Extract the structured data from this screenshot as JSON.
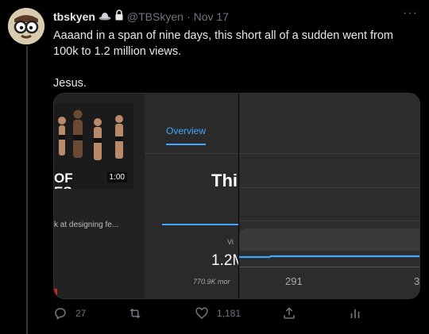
{
  "tweet": {
    "display_name": "tbskyen",
    "handle": "@TBSkyen",
    "separator": "·",
    "date": "Nov 17",
    "text_line1": "Aaaand in a span of nine days, this short all of a sudden went from 100k to 1.2 million views.",
    "text_line2": "Jesus.",
    "more_label": "···"
  },
  "media": {
    "thumbnail_title_line1": "OF",
    "thumbnail_title_line2": "ES",
    "thumbnail_duration": "1:00",
    "video_title_fragment": "k at designing fe...",
    "tab_overview": "Overview",
    "big_heading_fragment": "Thi",
    "views_label_fragment": "Vi",
    "views_value_fragment": "1.2M",
    "sub_value_fragment": "770.9K mor",
    "axis_tick_1": "291",
    "axis_tick_2": "3"
  },
  "actions": {
    "replies": "27",
    "retweets": "",
    "likes": "1,181"
  },
  "colors": {
    "accent_blue": "#3ea6ff",
    "background": "#000000",
    "text_primary": "#e7e9ea",
    "text_secondary": "#71767b"
  },
  "icons": {
    "avatar": "cartoon-face-with-glasses",
    "badge": "hat-icon",
    "lock": "lock-icon",
    "reply": "reply-icon",
    "retweet": "retweet-icon",
    "like": "heart-icon",
    "share": "share-icon",
    "analytics": "analytics-icon"
  }
}
